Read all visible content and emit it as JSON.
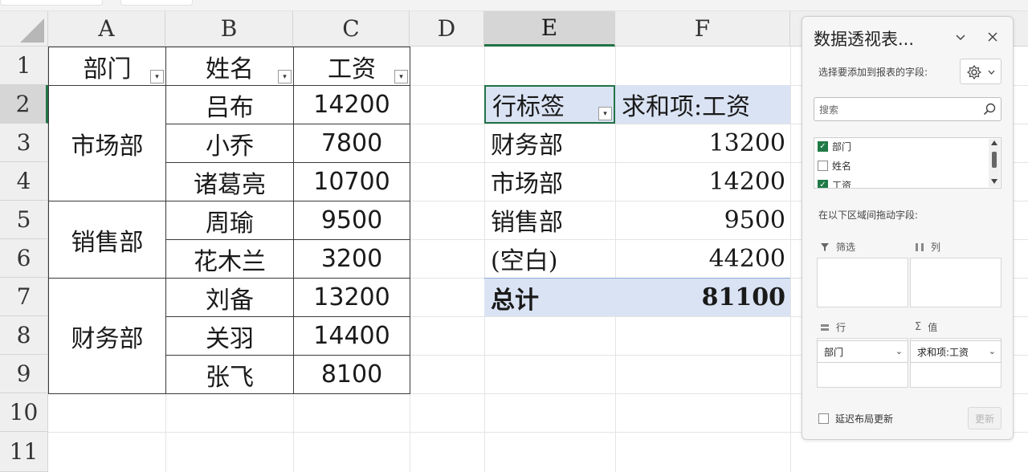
{
  "columns": [
    "A",
    "B",
    "C",
    "D",
    "E",
    "F"
  ],
  "rows": [
    "1",
    "2",
    "3",
    "4",
    "5",
    "6",
    "7",
    "8",
    "9",
    "10",
    "11"
  ],
  "source_table": {
    "headers": [
      "部门",
      "姓名",
      "工资"
    ],
    "departments": [
      "市场部",
      "销售部",
      "财务部"
    ],
    "names": [
      "吕布",
      "小乔",
      "诸葛亮",
      "周瑜",
      "花木兰",
      "刘备",
      "关羽",
      "张飞"
    ],
    "salaries": [
      "14200",
      "7800",
      "10700",
      "9500",
      "3200",
      "13200",
      "14400",
      "8100"
    ]
  },
  "pivot": {
    "row_label_header": "行标签",
    "value_header": "求和项:工资",
    "rows": [
      {
        "label": "财务部",
        "value": "13200"
      },
      {
        "label": "市场部",
        "value": "14200"
      },
      {
        "label": "销售部",
        "value": "9500"
      },
      {
        "label": "(空白)",
        "value": "44200"
      }
    ],
    "total_label": "总计",
    "total_value": "81100"
  },
  "field_pane": {
    "title": "数据透视表...",
    "choose_fields_label": "选择要添加到报表的字段:",
    "search_placeholder": "搜索",
    "fields": [
      {
        "name": "部门",
        "checked": true
      },
      {
        "name": "姓名",
        "checked": false
      },
      {
        "name": "工资",
        "checked": true
      }
    ],
    "drag_label": "在以下区域间拖动字段:",
    "filters_label": "筛选",
    "columns_label": "列",
    "rows_label": "行",
    "values_label": "值",
    "rows_item": "部门",
    "values_item": "求和项:工资",
    "defer_label": "延迟布局更新",
    "update_label": "更新"
  },
  "colors": {
    "pivot_header_fill": "#dae3f3",
    "accent_green": "#217346"
  }
}
